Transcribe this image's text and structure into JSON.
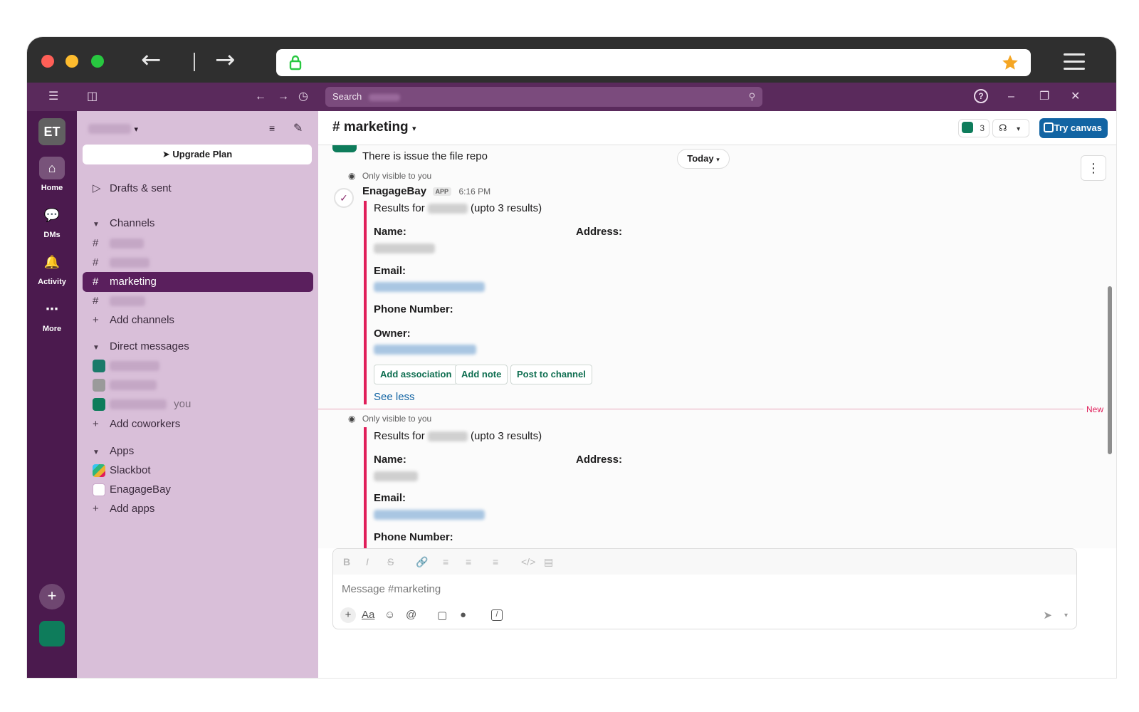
{
  "browser": {
    "lock_icon": "lock-icon",
    "star_icon": "star-icon"
  },
  "app": {
    "search_label": "Search",
    "workspace_initials": "ET",
    "help_icon": "?"
  },
  "rail": {
    "items": [
      {
        "label": "Home"
      },
      {
        "label": "DMs"
      },
      {
        "label": "Activity"
      },
      {
        "label": "More"
      }
    ]
  },
  "sidebar": {
    "upgrade_label": "Upgrade Plan",
    "drafts_label": "Drafts & sent",
    "channels_header": "Channels",
    "active_channel": "marketing",
    "add_channels": "Add channels",
    "dm_header": "Direct messages",
    "you_label": "you",
    "add_coworkers": "Add coworkers",
    "apps_header": "Apps",
    "apps": [
      {
        "label": "Slackbot"
      },
      {
        "label": "EnagageBay"
      }
    ],
    "add_apps": "Add apps"
  },
  "channel": {
    "title": "# marketing",
    "member_count": "3",
    "try_canvas": "Try canvas"
  },
  "messages": {
    "prev_text": "There is issue the file repo",
    "today_label": "Today",
    "only_visible": "Only visible to you",
    "sender": "EnagageBay",
    "app_tag": "APP",
    "time": "6:16 PM",
    "results_prefix": "Results for",
    "results_suffix": "(upto 3 results)",
    "name_label": "Name:",
    "address_label": "Address:",
    "email_label": "Email:",
    "phone_label": "Phone Number:",
    "owner_label": "Owner:",
    "btn_association": "Add association",
    "btn_note": "Add note",
    "btn_post": "Post to channel",
    "see_less": "See less",
    "new_label": "New"
  },
  "composer": {
    "placeholder": "Message #marketing"
  }
}
